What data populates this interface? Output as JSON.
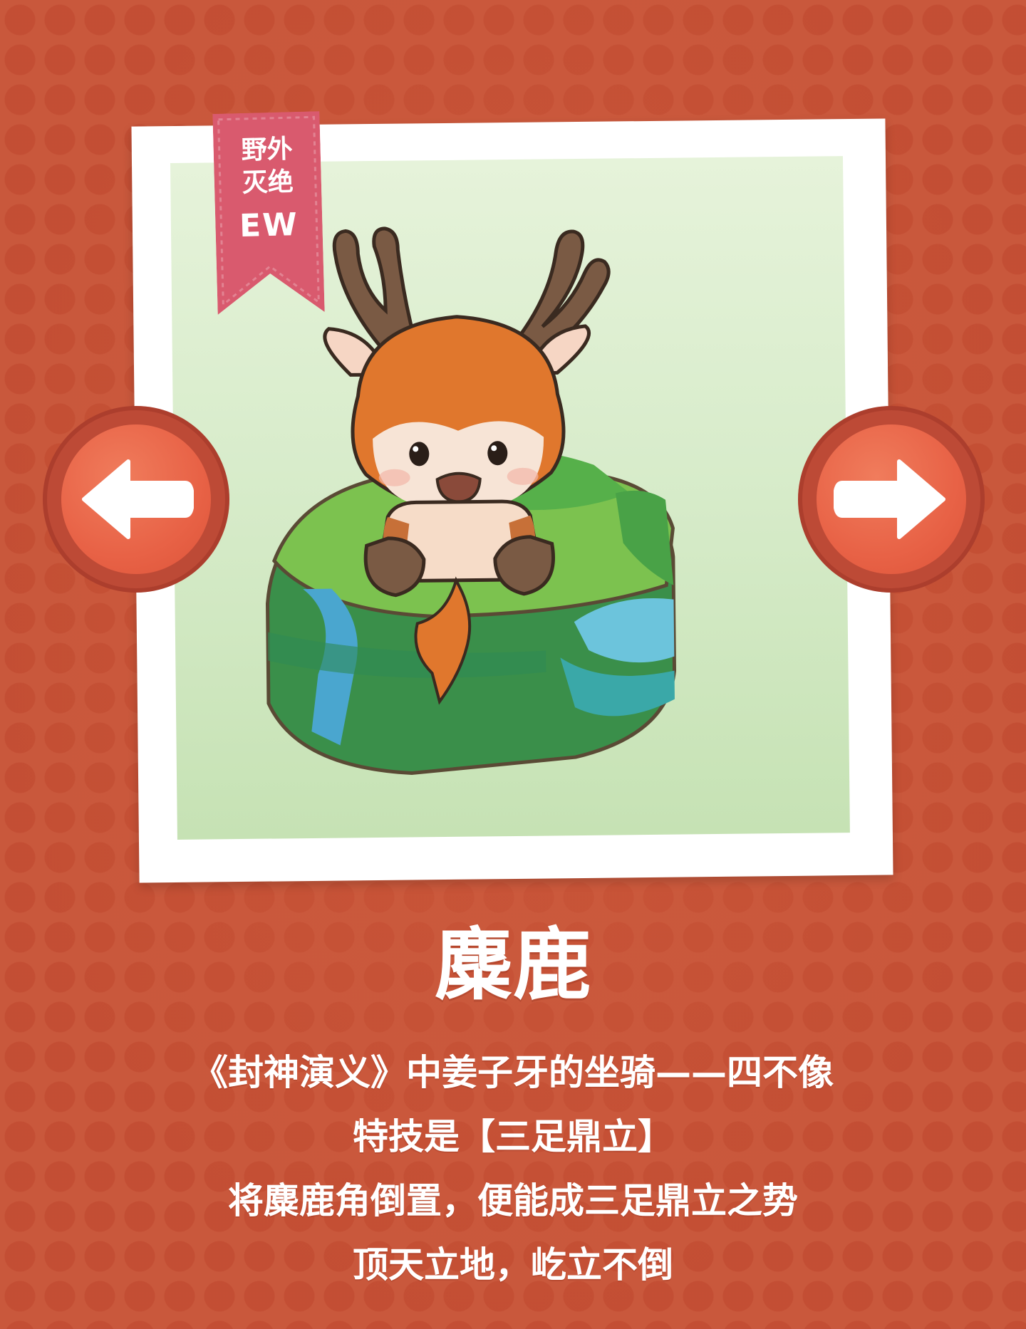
{
  "badge": {
    "line1": "野外",
    "line2": "灭绝",
    "code": "EW",
    "color": "#d95a6e"
  },
  "animal": {
    "name": "麋鹿",
    "description": [
      "《封神演义》中姜子牙的坐骑——四不像",
      "特技是【三足鼎立】",
      "将麋鹿角倒置，便能成三足鼎立之势",
      "顶天立地，屹立不倒"
    ]
  },
  "nav": {
    "prev_icon": "arrow-left-icon",
    "next_icon": "arrow-right-icon"
  },
  "colors": {
    "background": "#c9583c",
    "button": "#e86246",
    "frame": "#ffffff"
  }
}
